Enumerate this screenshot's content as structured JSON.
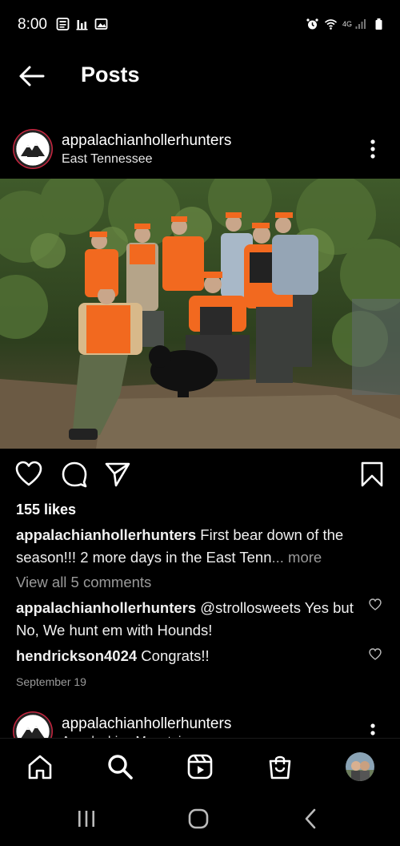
{
  "status_bar": {
    "time": "8:00",
    "left_icons": [
      "news-icon",
      "bar-chart-icon",
      "image-icon"
    ],
    "right_icons": [
      "alarm-icon",
      "wifi-icon",
      "lte-signal-icon",
      "battery-icon"
    ],
    "network_label": "4G"
  },
  "header": {
    "title": "Posts"
  },
  "post1": {
    "username": "appalachianhollerhunters",
    "location": "East Tennessee",
    "likes": "155 likes",
    "caption_user": "appalachianhollerhunters",
    "caption_text": " First bear down of the season!!! 2 more days in the East Tenn",
    "caption_more": "... more",
    "view_comments": "View all 5 comments",
    "comments": [
      {
        "user": "appalachianhollerhunters",
        "text": " @strollosweets Yes but No, We hunt em with Hounds!"
      },
      {
        "user": "hendrickson4024",
        "text": " Congrats!!"
      }
    ],
    "date": "September 19"
  },
  "post2": {
    "username": "appalachianhollerhunters",
    "location": "Appalachian Mountains"
  },
  "colors": {
    "background": "#000000",
    "text": "#f5f5f5",
    "muted": "#9a9a9a",
    "hunter_orange": "#f2691f",
    "avatar_ring": "#c9243f"
  }
}
